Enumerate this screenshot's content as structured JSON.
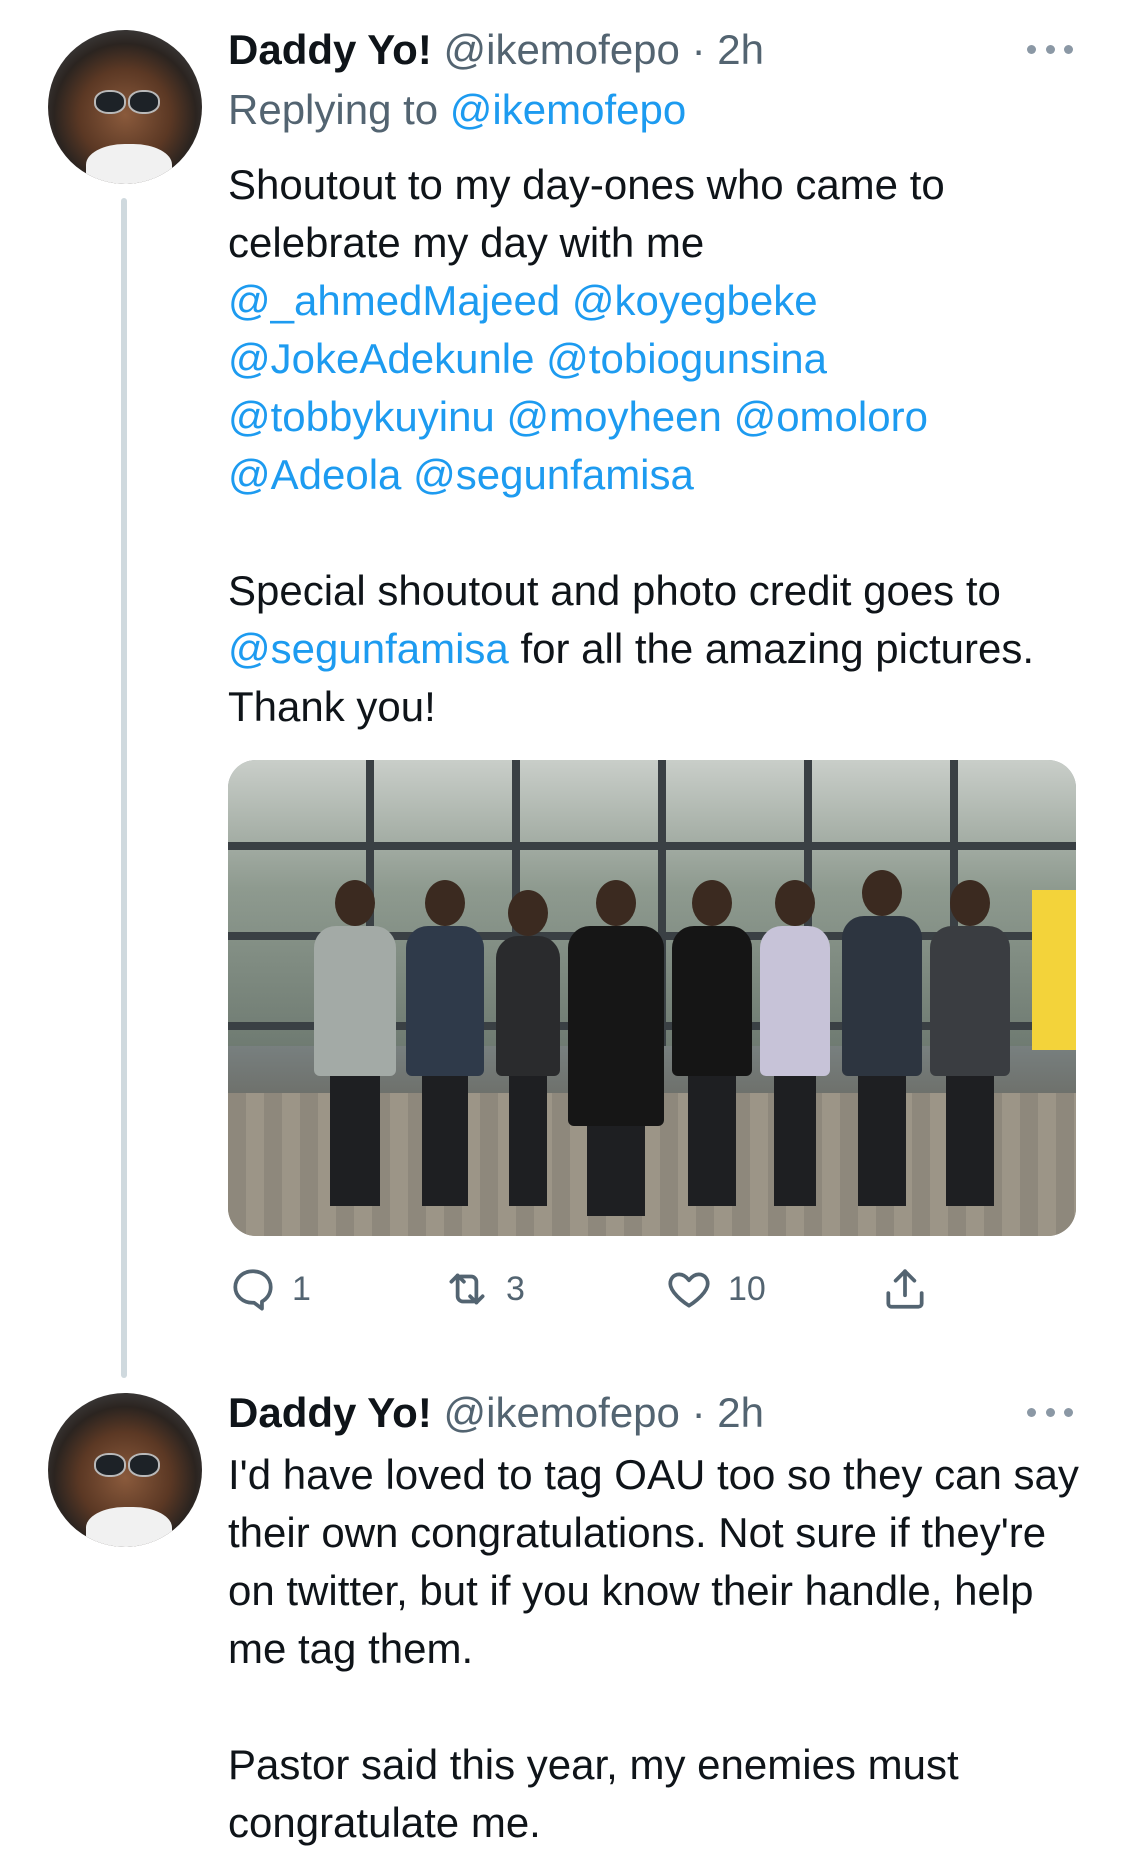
{
  "tweets": [
    {
      "display_name": "Daddy Yo!",
      "handle": "@ikemofepo",
      "time": " · 2h",
      "replying_label": "Replying to ",
      "replying_handle": "@ikemofepo",
      "paragraph1_text": "Shoutout to my day-ones who came to celebrate my day with me",
      "mentions": [
        "@_ahmedMajeed",
        "@koyegbeke",
        "@JokeAdekunle",
        "@tobiogunsina",
        "@tobbykuyinu",
        "@moyheen",
        "@omoloro",
        "@Adeola",
        "@segunfamisa"
      ],
      "paragraph2_start": "Special shoutout and photo credit goes to ",
      "paragraph2_mention": "@segunfamisa",
      "paragraph2_end": " for all the amazing pictures. Thank you!",
      "actions": {
        "reply": {
          "icon": "reply-icon",
          "count": "1"
        },
        "retweet": {
          "icon": "retweet-icon",
          "count": "3"
        },
        "like": {
          "icon": "heart-icon",
          "count": "10"
        },
        "share": {
          "icon": "share-icon"
        }
      }
    },
    {
      "display_name": "Daddy Yo!",
      "handle": "@ikemofepo",
      "time": " · 2h",
      "paragraph1": "I'd have loved to tag OAU too so they can say their own congratulations. Not sure if they're on twitter, but if you know their handle, help me tag them.",
      "paragraph2": "Pastor said this year, my enemies must congratulate me."
    }
  ],
  "colors": {
    "text": "#0f1419",
    "secondary": "#536471",
    "link": "#1d9bf0",
    "thread_line": "#cfd9de"
  }
}
